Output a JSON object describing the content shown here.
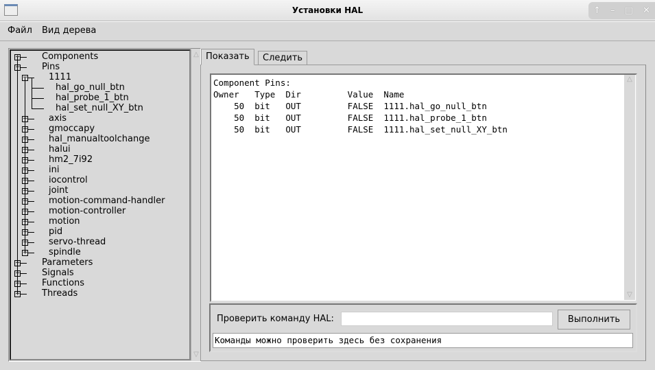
{
  "window": {
    "title": "Установки HAL",
    "controls": [
      "↑",
      "–",
      "□",
      "✕"
    ]
  },
  "menu": {
    "file": "Файл",
    "tree_view": "Вид дерева"
  },
  "tree": [
    {
      "label": "Components",
      "level": 0,
      "expander": "plus"
    },
    {
      "label": "Pins",
      "level": 0,
      "expander": "minus"
    },
    {
      "label": "1111",
      "level": 1,
      "expander": "minus"
    },
    {
      "label": "hal_go_null_btn",
      "level": 2,
      "expander": "none"
    },
    {
      "label": "hal_probe_1_btn",
      "level": 2,
      "expander": "none"
    },
    {
      "label": "hal_set_null_XY_btn",
      "level": 2,
      "expander": "none"
    },
    {
      "label": "axis",
      "level": 1,
      "expander": "plus"
    },
    {
      "label": "gmoccapy",
      "level": 1,
      "expander": "plus"
    },
    {
      "label": "hal_manualtoolchange",
      "level": 1,
      "expander": "plus"
    },
    {
      "label": "halui",
      "level": 1,
      "expander": "plus"
    },
    {
      "label": "hm2_7i92",
      "level": 1,
      "expander": "plus"
    },
    {
      "label": "ini",
      "level": 1,
      "expander": "plus"
    },
    {
      "label": "iocontrol",
      "level": 1,
      "expander": "plus"
    },
    {
      "label": "joint",
      "level": 1,
      "expander": "plus"
    },
    {
      "label": "motion-command-handler",
      "level": 1,
      "expander": "plus"
    },
    {
      "label": "motion-controller",
      "level": 1,
      "expander": "plus"
    },
    {
      "label": "motion",
      "level": 1,
      "expander": "plus"
    },
    {
      "label": "pid",
      "level": 1,
      "expander": "plus"
    },
    {
      "label": "servo-thread",
      "level": 1,
      "expander": "plus"
    },
    {
      "label": "spindle",
      "level": 1,
      "expander": "plus"
    },
    {
      "label": "Parameters",
      "level": 0,
      "expander": "plus"
    },
    {
      "label": "Signals",
      "level": 0,
      "expander": "plus"
    },
    {
      "label": "Functions",
      "level": 0,
      "expander": "plus"
    },
    {
      "label": "Threads",
      "level": 0,
      "expander": "plus"
    }
  ],
  "tabs": {
    "show": "Показать",
    "watch": "Следить",
    "active": "show"
  },
  "output": {
    "heading": "Component Pins:",
    "columns": [
      "Owner",
      "Type",
      "Dir",
      "Value",
      "Name"
    ],
    "rows": [
      [
        "50",
        "bit",
        "OUT",
        "FALSE",
        "1111.hal_go_null_btn"
      ],
      [
        "50",
        "bit",
        "OUT",
        "FALSE",
        "1111.hal_probe_1_btn"
      ],
      [
        "50",
        "bit",
        "OUT",
        "FALSE",
        "1111.hal_set_null_XY_btn"
      ]
    ]
  },
  "command": {
    "label": "Проверить команду HAL:",
    "value": "",
    "run_button": "Выполнить",
    "status": "Команды можно проверить здесь без сохранения"
  }
}
